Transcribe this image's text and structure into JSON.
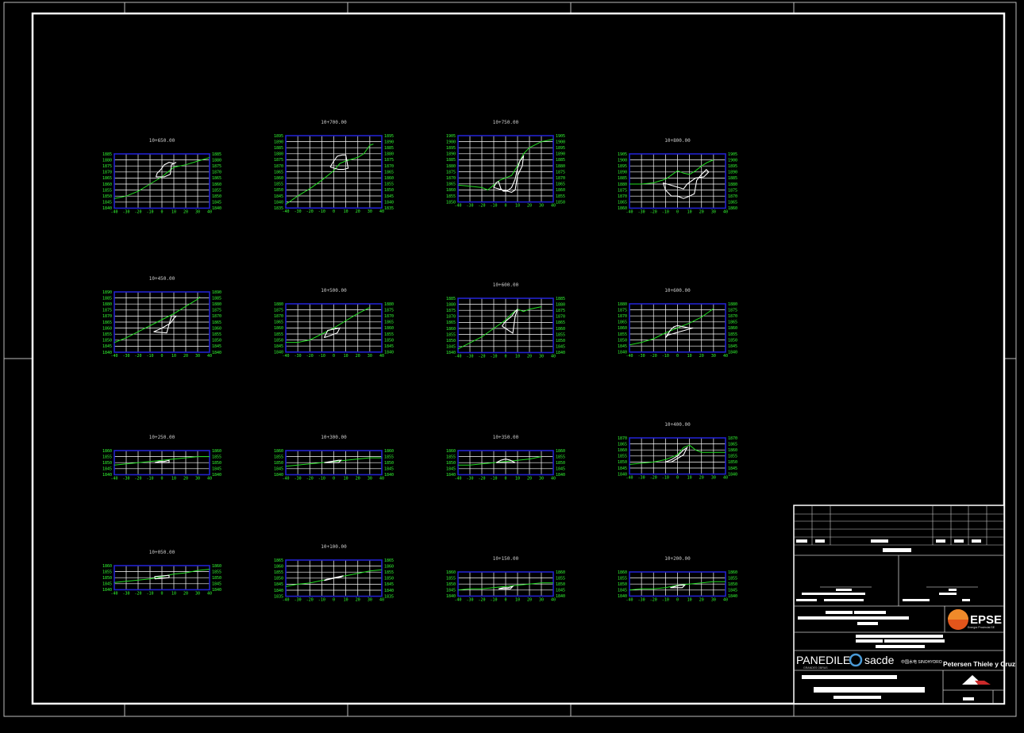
{
  "drawing": {
    "colors": {
      "background": "#000000",
      "frame": "#ffffff",
      "grid": "#ffffff",
      "box": "#2222cc",
      "terrain": "#22dd22",
      "road": "#ffffff",
      "ticks": "#33ff33"
    },
    "title_block": {
      "logos": {
        "epse": "EPSE",
        "epse_sub": "Energía Provincial SE",
        "panedile": "PANEDILE",
        "panedile_sub": "GRANDES OBRAS",
        "sacde": "sacde",
        "sinohydro": "中国水电 SINOHYDRO",
        "petersen": "Petersen Thiele y Cruz"
      }
    }
  },
  "chart_data": [
    {
      "type": "line",
      "title": "10+650.00",
      "xticks": [
        -40,
        -30,
        -20,
        -10,
        0,
        10,
        20,
        30,
        40
      ],
      "yticks": [
        1840,
        1845,
        1850,
        1855,
        1860,
        1865,
        1870,
        1875,
        1880,
        1885
      ],
      "ylim": [
        1840,
        1885
      ],
      "series": [
        {
          "x": [
            -40,
            -30,
            -20,
            -10,
            0,
            5,
            10,
            20,
            30,
            40
          ],
          "y": [
            1848,
            1850,
            1854,
            1860,
            1866,
            1870,
            1874,
            1876,
            1879,
            1882
          ]
        },
        {
          "x": [
            -5,
            -4,
            -1,
            2,
            6,
            10,
            12,
            8,
            7,
            2,
            -4,
            -5
          ],
          "y": [
            1866,
            1869,
            1872,
            1876,
            1878,
            1877,
            1878,
            1876,
            1868,
            1866,
            1866,
            1866
          ]
        }
      ]
    },
    {
      "type": "line",
      "title": "10+700.00",
      "xticks": [
        -40,
        -30,
        -20,
        -10,
        0,
        10,
        20,
        30,
        40
      ],
      "yticks": [
        1835,
        1840,
        1845,
        1850,
        1855,
        1860,
        1865,
        1870,
        1875,
        1880,
        1885,
        1890,
        1895
      ],
      "ylim": [
        1835,
        1895
      ],
      "series": [
        {
          "x": [
            -40,
            -30,
            -20,
            -10,
            0,
            5,
            10,
            20,
            25,
            30,
            33
          ],
          "y": [
            1838,
            1845,
            1851,
            1858,
            1866,
            1872,
            1874,
            1877,
            1880,
            1887,
            1888
          ]
        },
        {
          "x": [
            -3,
            0,
            3,
            7,
            10,
            12,
            8,
            4,
            -3
          ],
          "y": [
            1869,
            1874,
            1878,
            1879,
            1879,
            1868,
            1867,
            1867,
            1869
          ]
        }
      ]
    },
    {
      "type": "line",
      "title": "10+750.00",
      "xticks": [
        -40,
        -30,
        -20,
        -10,
        0,
        10,
        20,
        30,
        40
      ],
      "yticks": [
        1850,
        1855,
        1860,
        1865,
        1870,
        1875,
        1880,
        1885,
        1890,
        1895,
        1900,
        1905
      ],
      "ylim": [
        1850,
        1905
      ],
      "series": [
        {
          "x": [
            -40,
            -30,
            -20,
            -15,
            -10,
            -5,
            0,
            5,
            10,
            15,
            20,
            30,
            40
          ],
          "y": [
            1864,
            1863,
            1862,
            1860,
            1864,
            1868,
            1870,
            1872,
            1880,
            1890,
            1895,
            1900,
            1902
          ]
        },
        {
          "x": [
            -10,
            -8,
            -6,
            -4,
            -2,
            1,
            5,
            8,
            10,
            12,
            15,
            14,
            10,
            8,
            5,
            -10
          ],
          "y": [
            1862,
            1866,
            1867,
            1861,
            1859,
            1859,
            1862,
            1869,
            1878,
            1884,
            1888,
            1880,
            1872,
            1860,
            1858,
            1862
          ]
        }
      ]
    },
    {
      "type": "line",
      "title": "10+800.00",
      "xticks": [
        -40,
        -30,
        -20,
        -10,
        0,
        10,
        20,
        30,
        40
      ],
      "yticks": [
        1860,
        1865,
        1870,
        1875,
        1880,
        1885,
        1890,
        1895,
        1900,
        1905
      ],
      "ylim": [
        1860,
        1905
      ],
      "series": [
        {
          "x": [
            -40,
            -30,
            -20,
            -10,
            0,
            5,
            10,
            15,
            20,
            25,
            30
          ],
          "y": [
            1880,
            1880,
            1881,
            1884,
            1891,
            1889,
            1888,
            1891,
            1895,
            1898,
            1900
          ]
        },
        {
          "x": [
            -12,
            -10,
            -5,
            0,
            5,
            10,
            14,
            16,
            20,
            24,
            26,
            22,
            15,
            8,
            5,
            -12
          ],
          "y": [
            1881,
            1875,
            1870,
            1870,
            1868,
            1870,
            1872,
            1883,
            1888,
            1892,
            1890,
            1886,
            1885,
            1880,
            1876,
            1881
          ]
        }
      ]
    },
    {
      "type": "line",
      "title": "10+450.00",
      "xticks": [
        -40,
        -30,
        -20,
        -10,
        0,
        10,
        20,
        30,
        40
      ],
      "yticks": [
        1840,
        1845,
        1850,
        1855,
        1860,
        1865,
        1870,
        1875,
        1880,
        1885,
        1890
      ],
      "ylim": [
        1840,
        1890
      ],
      "series": [
        {
          "x": [
            -40,
            -30,
            -20,
            -10,
            0,
            10,
            20,
            30,
            32
          ],
          "y": [
            1848,
            1852,
            1857,
            1862,
            1867,
            1872,
            1878,
            1884,
            1886
          ]
        },
        {
          "x": [
            -7,
            0,
            7,
            10,
            12,
            8,
            4,
            -7
          ],
          "y": [
            1857,
            1860,
            1864,
            1868,
            1870,
            1870,
            1856,
            1857
          ]
        }
      ]
    },
    {
      "type": "line",
      "title": "10+500.00",
      "xticks": [
        -40,
        -30,
        -20,
        -10,
        0,
        10,
        20,
        30,
        40
      ],
      "yticks": [
        1840,
        1845,
        1850,
        1855,
        1860,
        1865,
        1870,
        1875,
        1880
      ],
      "ylim": [
        1840,
        1880
      ],
      "series": [
        {
          "x": [
            -40,
            -30,
            -20,
            -10,
            0,
            10,
            20,
            30
          ],
          "y": [
            1848,
            1848,
            1850,
            1855,
            1860,
            1866,
            1872,
            1877
          ]
        },
        {
          "x": [
            -8,
            -5,
            0,
            5,
            3,
            -2,
            -8
          ],
          "y": [
            1852,
            1858,
            1859,
            1860,
            1856,
            1854,
            1852
          ]
        }
      ]
    },
    {
      "type": "line",
      "title": "10+600.00",
      "xticks": [
        -40,
        -30,
        -20,
        -10,
        0,
        10,
        20,
        30,
        40
      ],
      "yticks": [
        1840,
        1845,
        1850,
        1855,
        1860,
        1865,
        1870,
        1875,
        1880,
        1885
      ],
      "ylim": [
        1840,
        1885
      ],
      "series": [
        {
          "x": [
            -40,
            -30,
            -20,
            -10,
            0,
            5,
            10,
            15,
            20,
            30
          ],
          "y": [
            1843,
            1848,
            1853,
            1860,
            1867,
            1872,
            1876,
            1874,
            1876,
            1878
          ]
        },
        {
          "x": [
            -3,
            0,
            5,
            8,
            10,
            8,
            6,
            -3
          ],
          "y": [
            1862,
            1866,
            1870,
            1874,
            1876,
            1870,
            1856,
            1862
          ]
        }
      ]
    },
    {
      "type": "line",
      "title": "10+600.00",
      "xticks": [
        -40,
        -30,
        -20,
        -10,
        0,
        10,
        20,
        30,
        40
      ],
      "yticks": [
        1840,
        1845,
        1850,
        1855,
        1860,
        1865,
        1870,
        1875,
        1880
      ],
      "ylim": [
        1840,
        1880
      ],
      "series": [
        {
          "x": [
            -40,
            -30,
            -20,
            -10,
            0,
            10,
            20,
            30
          ],
          "y": [
            1846,
            1848,
            1851,
            1856,
            1860,
            1864,
            1869,
            1876
          ]
        },
        {
          "x": [
            -10,
            -6,
            -3,
            0,
            5,
            10,
            13,
            6,
            -8,
            -10
          ],
          "y": [
            1852,
            1858,
            1861,
            1862,
            1861,
            1860,
            1860,
            1858,
            1854,
            1852
          ]
        }
      ]
    },
    {
      "type": "line",
      "title": "10+250.00",
      "xticks": [
        -40,
        -30,
        -20,
        -10,
        0,
        10,
        20,
        30,
        40
      ],
      "yticks": [
        1840,
        1845,
        1850,
        1855,
        1860
      ],
      "ylim": [
        1840,
        1860
      ],
      "series": [
        {
          "x": [
            -40,
            -30,
            -20,
            -10,
            0,
            10,
            20,
            30,
            40
          ],
          "y": [
            1848,
            1849,
            1850,
            1851,
            1852,
            1853,
            1854,
            1855,
            1855
          ]
        },
        {
          "x": [
            -6,
            -2,
            2,
            6,
            6,
            -6
          ],
          "y": [
            1850,
            1851,
            1851,
            1852,
            1850,
            1850
          ]
        }
      ]
    },
    {
      "type": "line",
      "title": "10+300.00",
      "xticks": [
        -40,
        -30,
        -20,
        -10,
        0,
        10,
        20,
        30,
        40
      ],
      "yticks": [
        1840,
        1845,
        1850,
        1855,
        1860
      ],
      "ylim": [
        1840,
        1860
      ],
      "series": [
        {
          "x": [
            -40,
            -30,
            -20,
            -10,
            0,
            10,
            20,
            30,
            40
          ],
          "y": [
            1847,
            1848,
            1849,
            1850,
            1851,
            1852,
            1853,
            1854,
            1854
          ]
        },
        {
          "x": [
            -8,
            -2,
            4,
            6,
            4,
            -8
          ],
          "y": [
            1850,
            1851,
            1852,
            1852,
            1850,
            1850
          ]
        }
      ]
    },
    {
      "type": "line",
      "title": "10+350.00",
      "xticks": [
        -40,
        -30,
        -20,
        -10,
        0,
        10,
        20,
        30,
        40
      ],
      "yticks": [
        1840,
        1845,
        1850,
        1855,
        1860
      ],
      "ylim": [
        1840,
        1860
      ],
      "series": [
        {
          "x": [
            -40,
            -30,
            -20,
            -10,
            0,
            10,
            20,
            30
          ],
          "y": [
            1848,
            1848,
            1849,
            1850,
            1851,
            1852,
            1853,
            1855
          ]
        },
        {
          "x": [
            -8,
            -4,
            0,
            4,
            8,
            4,
            -8
          ],
          "y": [
            1850,
            1852,
            1853,
            1852,
            1850,
            1850,
            1850
          ]
        }
      ]
    },
    {
      "type": "line",
      "title": "10+400.00",
      "xticks": [
        -40,
        -30,
        -20,
        -10,
        0,
        10,
        20,
        30,
        40
      ],
      "yticks": [
        1840,
        1845,
        1850,
        1855,
        1860,
        1865,
        1870
      ],
      "ylim": [
        1840,
        1870
      ],
      "series": [
        {
          "x": [
            -40,
            -30,
            -20,
            -10,
            0,
            5,
            10,
            15,
            20,
            30,
            40
          ],
          "y": [
            1848,
            1849,
            1850,
            1852,
            1856,
            1862,
            1864,
            1860,
            1858,
            1858,
            1858
          ]
        },
        {
          "x": [
            -10,
            -5,
            0,
            5,
            8,
            5,
            -5,
            -10
          ],
          "y": [
            1850,
            1852,
            1855,
            1860,
            1862,
            1856,
            1850,
            1850
          ]
        }
      ]
    },
    {
      "type": "line",
      "title": "10+050.00",
      "xticks": [
        -40,
        -30,
        -20,
        -10,
        0,
        10,
        20,
        30,
        40
      ],
      "yticks": [
        1840,
        1845,
        1850,
        1855,
        1860
      ],
      "ylim": [
        1840,
        1860
      ],
      "series": [
        {
          "x": [
            -40,
            -30,
            -20,
            -10,
            0,
            10,
            20,
            30,
            40
          ],
          "y": [
            1846,
            1847,
            1848,
            1849,
            1851,
            1853,
            1854,
            1856,
            1857
          ]
        },
        {
          "x": [
            -6,
            6,
            6,
            -6,
            -6
          ],
          "y": [
            1849,
            1850,
            1852,
            1851,
            1849
          ]
        }
      ]
    },
    {
      "type": "line",
      "title": "10+100.00",
      "xticks": [
        -40,
        -30,
        -20,
        -10,
        0,
        10,
        20,
        30,
        40
      ],
      "yticks": [
        1835,
        1840,
        1845,
        1850,
        1855,
        1860,
        1865
      ],
      "ylim": [
        1835,
        1865
      ],
      "series": [
        {
          "x": [
            -40,
            -30,
            -20,
            -10,
            0,
            10,
            20,
            30,
            40
          ],
          "y": [
            1843,
            1845,
            1846,
            1848,
            1850,
            1852,
            1854,
            1856,
            1857
          ]
        },
        {
          "x": [
            -8,
            -4,
            0,
            6,
            8,
            -6,
            -8
          ],
          "y": [
            1848,
            1849,
            1850,
            1851,
            1852,
            1849,
            1848
          ]
        }
      ]
    },
    {
      "type": "line",
      "title": "10+150.00",
      "xticks": [
        -40,
        -30,
        -20,
        -10,
        0,
        10,
        20,
        30,
        40
      ],
      "yticks": [
        1840,
        1845,
        1850,
        1855,
        1860
      ],
      "ylim": [
        1840,
        1860
      ],
      "series": [
        {
          "x": [
            -40,
            -30,
            -20,
            -10,
            0,
            10,
            20,
            30,
            40
          ],
          "y": [
            1845,
            1846,
            1846,
            1847,
            1848,
            1849,
            1850,
            1851,
            1851
          ]
        },
        {
          "x": [
            -6,
            -2,
            2,
            6,
            4,
            -6
          ],
          "y": [
            1846,
            1847,
            1847,
            1848,
            1846,
            1846
          ]
        }
      ]
    },
    {
      "type": "line",
      "title": "10+200.00",
      "xticks": [
        -40,
        -30,
        -20,
        -10,
        0,
        10,
        20,
        30,
        40
      ],
      "yticks": [
        1840,
        1845,
        1850,
        1855,
        1860
      ],
      "ylim": [
        1840,
        1860
      ],
      "series": [
        {
          "x": [
            -40,
            -30,
            -20,
            -10,
            0,
            10,
            20,
            30,
            40
          ],
          "y": [
            1845,
            1846,
            1846,
            1847,
            1849,
            1850,
            1851,
            1852,
            1852
          ]
        },
        {
          "x": [
            -6,
            -2,
            2,
            6,
            4,
            -6
          ],
          "y": [
            1847,
            1848,
            1849,
            1849,
            1847,
            1847
          ]
        }
      ]
    }
  ]
}
